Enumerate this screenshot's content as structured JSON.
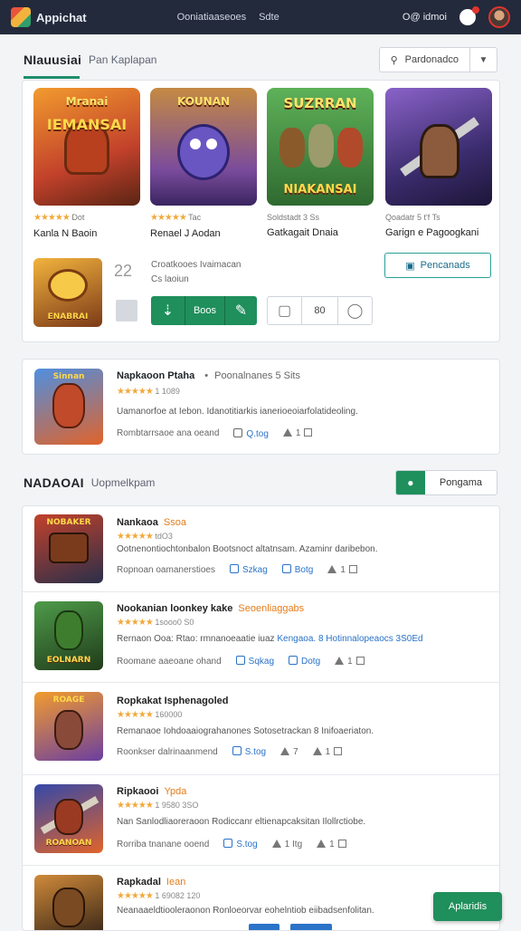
{
  "topbar": {
    "brand": "Appichat",
    "nav": [
      "Ooniatiaaseoes",
      "Sdte"
    ],
    "region": "O@ idmoi"
  },
  "featured": {
    "title": "NIauusiai",
    "sub": "Pan Kaplapan",
    "sort_label": "Pardonadco",
    "tiles": [
      {
        "art_top": "Mranai",
        "art_caption": "IEMANSAI",
        "rating_text": "Dot",
        "name": "Kanla N Baoin",
        "colors": [
          "#f07b2a",
          "#8a2f1c"
        ]
      },
      {
        "art_top": "KOUNAN",
        "art_caption": "",
        "rating_text": "Tac",
        "name": "Renael J Aodan",
        "colors": [
          "#6a4fa0",
          "#c58a43"
        ]
      },
      {
        "art_top": "SUZRRAN",
        "art_caption": "NIAKANSAI",
        "rating_text": "Soldstadt 3 Ss",
        "name": "Gatkagait Dnaia",
        "colors": [
          "#4e9b4a",
          "#2a5a2b"
        ]
      },
      {
        "art_top": "",
        "art_caption": "",
        "rating_text": "Qoadatr 5 t'f Ts",
        "name": "Garign e Pagoogkani",
        "colors": [
          "#5b3f9e",
          "#2c2250"
        ]
      }
    ],
    "small_tile_caption": "ENABRAI",
    "small_info_num": "22",
    "small_info_l1": "Croatkooes Ivaimacan",
    "small_info_l2": "Cs laoiun",
    "teal_btn_label": "Pencanads",
    "green_btn_label": "Boos",
    "counter_value": "80"
  },
  "highlight": {
    "title": "Napkaoon Ptaha",
    "extra": "Poonalnanes 5 Sits",
    "rating_text": "1 1089",
    "desc": "Uamanorfoe at Iebon. Idanotitiarkis ianerioeoiarfolatideoling.",
    "action_left": "Rombtarrsaoe ana oeand",
    "action_mid": "Q.tog",
    "action_right": "1",
    "thumb_caption": "Sinnan"
  },
  "second": {
    "title": "NADAOAI",
    "sub": "Uopmelkpam",
    "btn_label": "Pongama"
  },
  "list": [
    {
      "title": "Nankaoa",
      "hl": "Ssoa",
      "rating_text": "tdO3",
      "desc": "Ootnenontiochtonbalon Bootsnoct altatnsam. Azaminr daribebon.",
      "desc_link": "",
      "a1": "Ropnoan oamanerstioes",
      "a2": "Szkag",
      "a3": "Botg",
      "a4": "1",
      "thumb_caption": "NOBAKER",
      "colors": [
        "#c2412b",
        "#2b2f4a"
      ]
    },
    {
      "title": "Nookanian loonkey kake",
      "hl": "Seoenliaggabs",
      "rating_text": "1sooo0 S0",
      "desc": "Rernaon Ooa: Rtao: rmnanoeaatie iuaz",
      "desc_link": "Kengaoa. 8 Hotinnalopeaocs 3S0Ed",
      "a1": "Roomane aaeoane ohand",
      "a2": "Sqkag",
      "a3": "Dotg",
      "a4": "1",
      "thumb_caption": "EOLNARN",
      "colors": [
        "#3e7d2e",
        "#203b1a"
      ]
    },
    {
      "title": "Ropkakat Isphenagoled",
      "hl": "",
      "rating_text": "160000",
      "desc": "Remanaoe Iohdoaaiograhanones Sotosetrackan 8 Inifoaeriaton.",
      "desc_link": "",
      "a1": "Roonkser dalrinaanmend",
      "a2": "S.tog",
      "a3": "7",
      "a4": "1",
      "thumb_caption": "ROAGE",
      "colors": [
        "#6b3fa0",
        "#f29b2e"
      ]
    },
    {
      "title": "Ripkaooi",
      "hl": "Ypda",
      "rating_text": "1 9580 3SO",
      "desc": "Nan Sanlodliaoreraoon Rodiccanr eltienapcaksitan Ilollrctiobe.",
      "desc_link": "",
      "a1": "Rorriba tnanane ooend",
      "a2": "S.tog",
      "a3": "1 Itg",
      "a4": "1",
      "thumb_caption": "ROANOAN",
      "colors": [
        "#3548a8",
        "#e0632a"
      ]
    },
    {
      "title": "Rapkadal",
      "hl": "Iean",
      "rating_text": "1 69082 120",
      "desc": "Neanaaeldtiooleraonon Ronloeorvar eohelntiob eiibadsenfolitan.",
      "desc_link": "",
      "a1": "",
      "a2": "",
      "a3": "",
      "a4": "",
      "thumb_caption": "",
      "colors": [
        "#8a4a1c",
        "#2a1d14"
      ]
    }
  ],
  "fab_label": "Aplaridis"
}
